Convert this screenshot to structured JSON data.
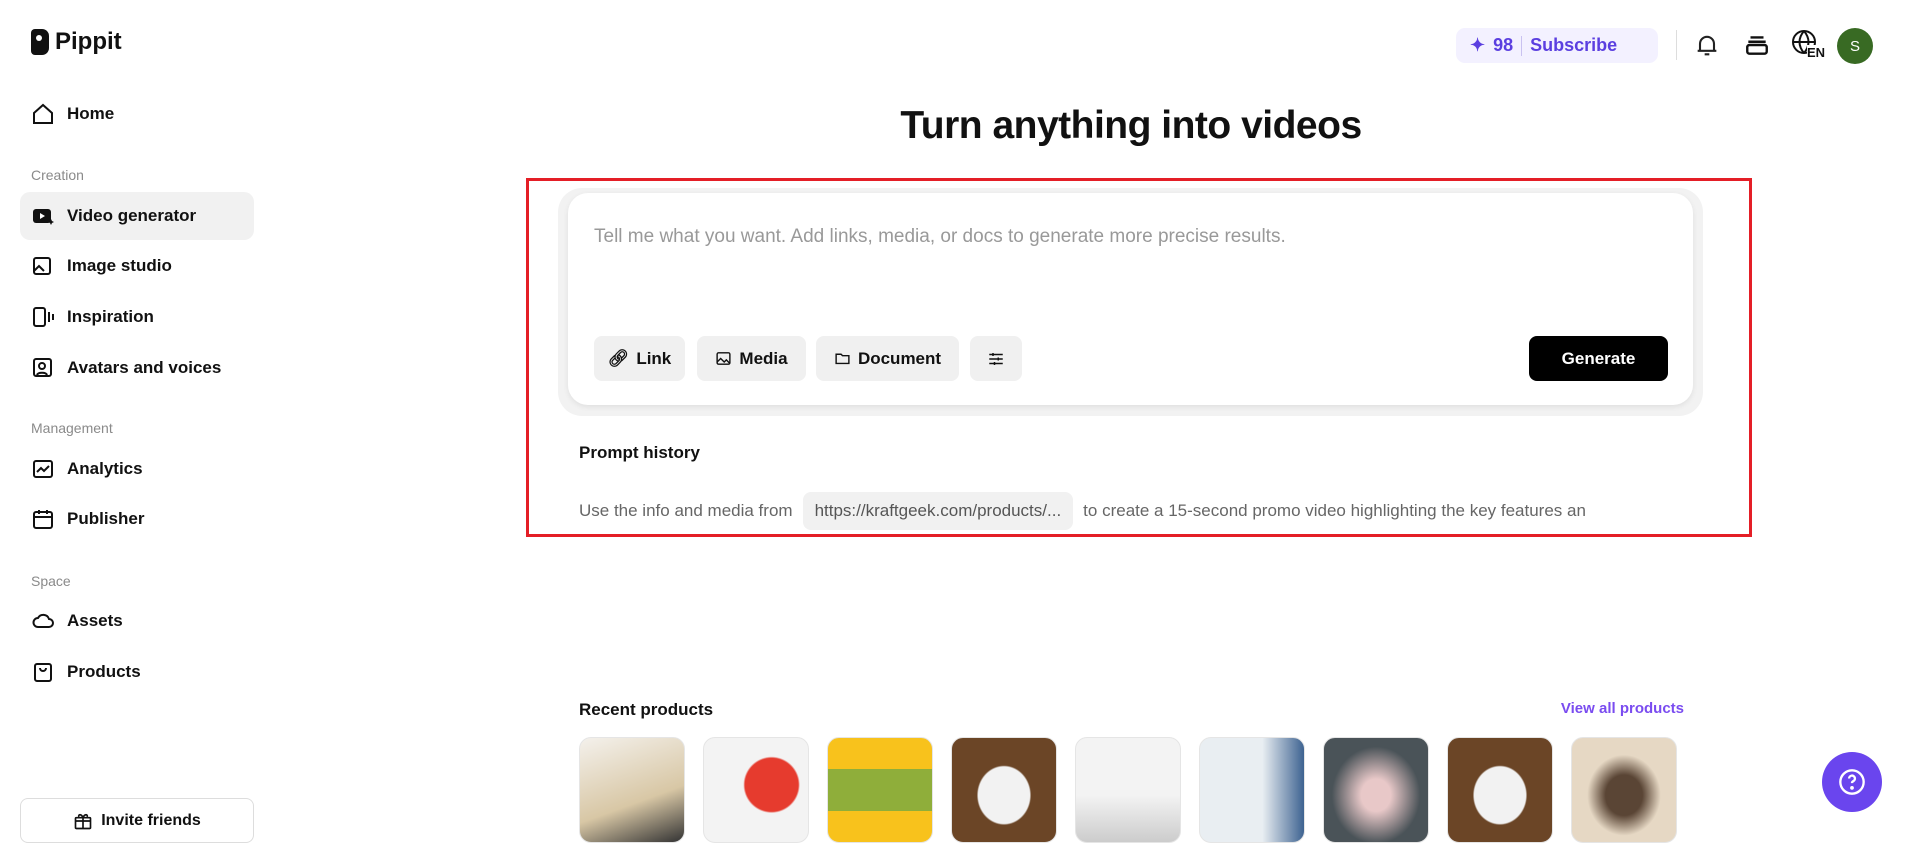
{
  "brand": {
    "name": "Pippit"
  },
  "sidebar": {
    "home": "Home",
    "sections": {
      "creation": "Creation",
      "management": "Management",
      "space": "Space"
    },
    "items": [
      {
        "label": "Video generator"
      },
      {
        "label": "Image studio"
      },
      {
        "label": "Inspiration"
      },
      {
        "label": "Avatars and voices"
      },
      {
        "label": "Analytics"
      },
      {
        "label": "Publisher"
      },
      {
        "label": "Assets"
      },
      {
        "label": "Products"
      }
    ],
    "invite": "Invite friends"
  },
  "header": {
    "credits": "98",
    "subscribe": "Subscribe",
    "language": "EN",
    "avatar_initial": "S"
  },
  "main": {
    "title": "Turn anything into videos",
    "prompt_placeholder": "Tell me what you want. Add links, media, or docs to generate more precise results.",
    "tools": {
      "link": "Link",
      "media": "Media",
      "document": "Document"
    },
    "generate": "Generate",
    "history": {
      "heading": "Prompt history",
      "prefix": "Use the info and media from",
      "url": "https://kraftgeek.com/products/...",
      "suffix": "to create a 15-second promo video highlighting the key features an"
    },
    "recent_products": {
      "heading": "Recent products",
      "view_all": "View all products"
    }
  },
  "colors": {
    "accent": "#6a45ee",
    "highlight": "#e41e26",
    "avatar": "#386a23"
  }
}
